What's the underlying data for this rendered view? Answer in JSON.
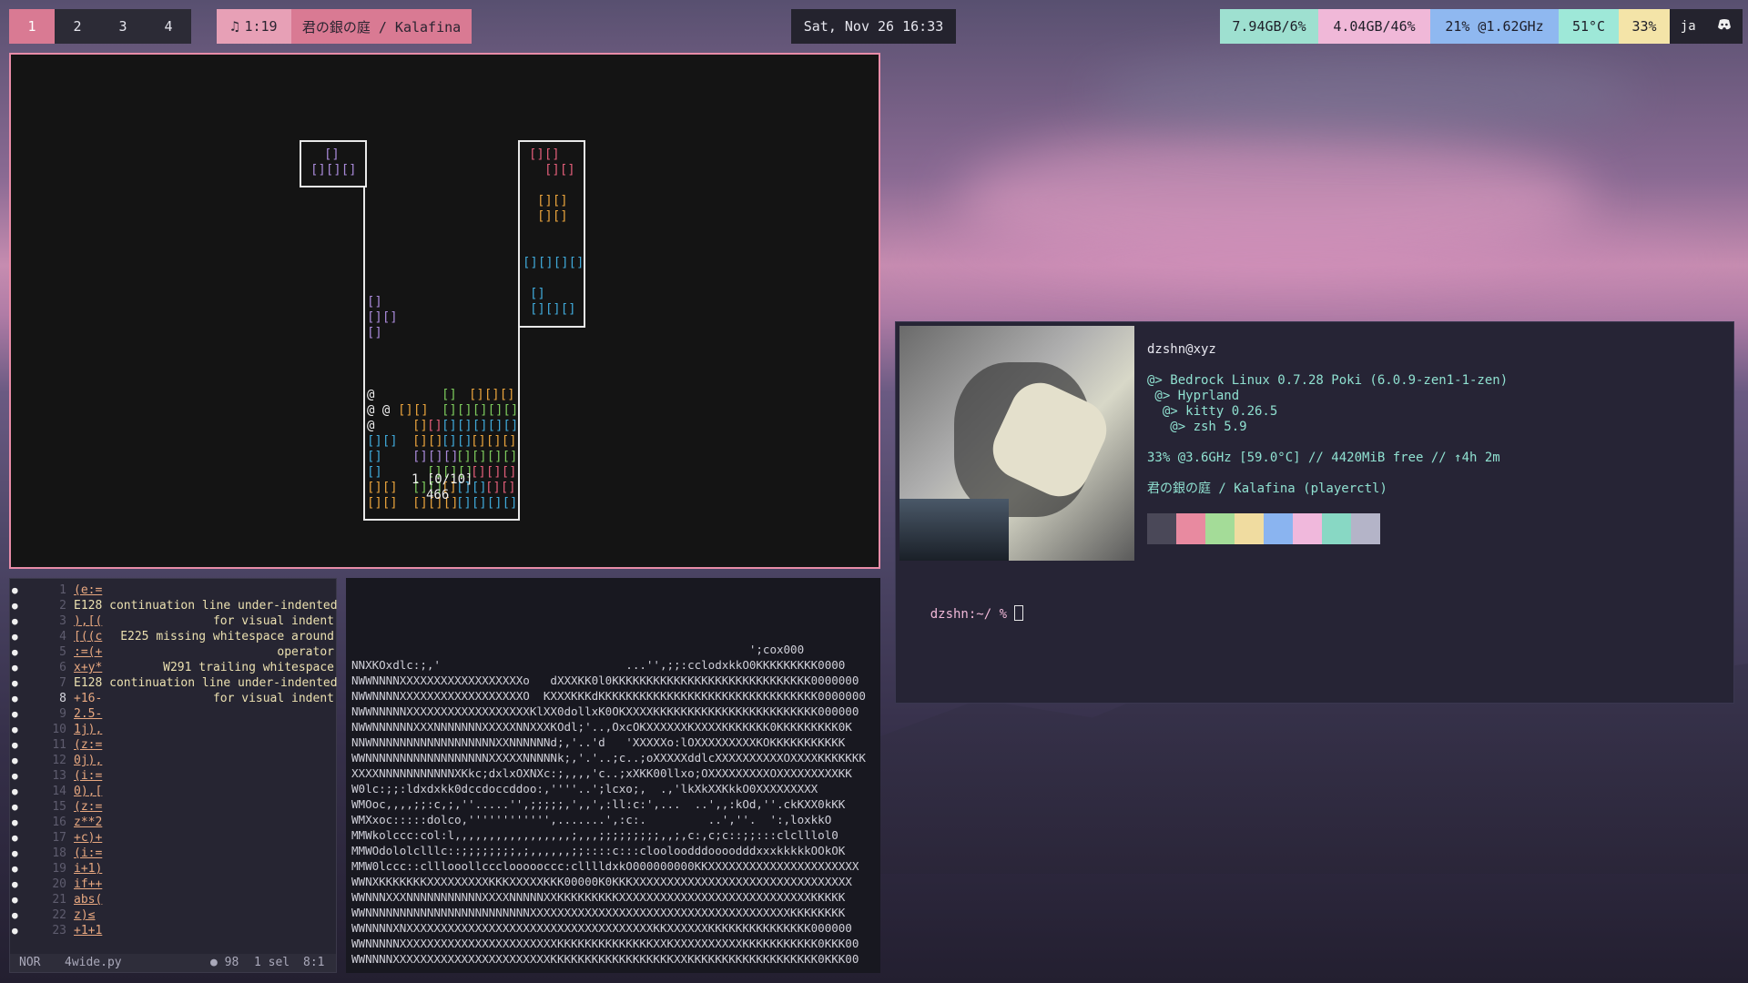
{
  "workspaces": [
    {
      "label": "1",
      "active": true
    },
    {
      "label": "2"
    },
    {
      "label": "3"
    },
    {
      "label": "4"
    }
  ],
  "media": {
    "icon": "music-note-icon",
    "time": "1:19",
    "title": "君の銀の庭 / Kalafina"
  },
  "clock": "Sat, Nov 26 16:33",
  "stats": [
    {
      "name": "disk",
      "text": "7.94GB/6%",
      "color": "#9ee0d0"
    },
    {
      "name": "memory",
      "text": "4.04GB/46%",
      "color": "#f0b8d8"
    },
    {
      "name": "cpu",
      "text": "21% @1.62GHz",
      "color": "#8fb8f0"
    },
    {
      "name": "temperature",
      "text": "51°C",
      "color": "#9ee8d8"
    },
    {
      "name": "battery",
      "text": "33%",
      "color": "#f4e4a8"
    }
  ],
  "locale": "ja",
  "tray_icon": "discord-icon",
  "tetris": {
    "line1": "1 [0/10]",
    "line2": "466"
  },
  "editor": {
    "lines": [
      {
        "n": "1",
        "code": "(e:="
      },
      {
        "n": "2",
        "code": "E128 continuation line under-indented",
        "diag": true
      },
      {
        "n": "3",
        "code": "),[(",
        "diag_text": "for visual indent"
      },
      {
        "n": "4",
        "code": "[((c",
        "diag_text": "E225 missing whitespace around"
      },
      {
        "n": "5",
        "code": ":=(+",
        "diag_text": "operator"
      },
      {
        "n": "6",
        "code": "x+y*",
        "diag_text": "W291 trailing whitespace"
      },
      {
        "n": "7",
        "code": "E128 continuation line under-indented",
        "diag": true
      },
      {
        "n": "8",
        "code": "+16-",
        "diag_text": "for visual indent",
        "current": true
      },
      {
        "n": "9",
        "code": "2.5-"
      },
      {
        "n": "10",
        "code": "1j),"
      },
      {
        "n": "11",
        "code": "(z:="
      },
      {
        "n": "12",
        "code": "0j),"
      },
      {
        "n": "13",
        "code": "(i:="
      },
      {
        "n": "14",
        "code": "0),["
      },
      {
        "n": "15",
        "code": "(z:="
      },
      {
        "n": "16",
        "code": "z**2"
      },
      {
        "n": "17",
        "code": "+c)+"
      },
      {
        "n": "18",
        "code": "(i:="
      },
      {
        "n": "19",
        "code": "i+1)"
      },
      {
        "n": "20",
        "code": "if++"
      },
      {
        "n": "21",
        "code": "abs("
      },
      {
        "n": "22",
        "code": "z)≤"
      },
      {
        "n": "23",
        "code": "+1+1"
      }
    ],
    "status": {
      "mode": "NOR",
      "file": "4wide.py",
      "diagnostics": "● 98",
      "selection": "1 sel",
      "position": "8:1"
    }
  },
  "ascii_art": [
    "                                                          ';cox000",
    "NNXKOxdlc:;,'                           ...'',;;:cclodxkkO0KKKKKKKKK0000",
    "NWWNNNNXXXXXXXXXXXXXXXXXXo   dXXXKK0l0KKKKKKKKKKKKKKKKKKKKKKKKKKKKK0000000",
    "NWWNNNNXXXXXXXXXXXXXXXXXXO  KXXXKKKdKKKKKKKKKKKKKKKKKKKKKKKKKKKKKKKK0000000",
    "NWWNNNNNXXXXXXXXXXXXXXXXXXKlXX0dollxK0OKXXXXKKKKKKKKKKKKKKKKKKKKKKKK000000",
    "NWWNNNNNNXXXNNNNNNNXXXXXNNXXXKOdl;'..,OxcOKXXXXXXKXXXXKKKKKKK0KKKKKKKKK0K",
    "NNWNNNNNNNNNNNNNNNNNNXXNNNNNNd;,'..'d   'XXXXXo:lOXXXXXXXXXKOKKKKKKKKKKK",
    "WWNNNNNNNNNNNNNNNNNNXXXXXNNNNNk;,'.'..;c..;oXXXXXddlcXXXXXXXXXXOXXXXKKKKKKK",
    "XXXXNNNNNNNNNNNXKkc;dxlxOXNXc:;,,,,'c..;xXKK00llxo;OXXXXXXXXXOXXXXXXXXXKK",
    "W0lc:;;:ldxdxkk0dccdoccddoo:,''''..';lcxo;,  .,'lkXkXXKkkO0XXXXXXXXX",
    "WMOoc,,,,;;:c,;,''.....'',;;;;;,',,',:ll:c:',...  ..',,:kOd,''.ckKXX0kKK",
    "WMXxoc:::::dolco,'''''''''''',.......',:c:.         ..',''.  ':,loxkkO",
    "MMWkolccc:col:l,,,,,,,,,,,,,,,,,;,,,;;;;;;;;;,,;,c:,c;c::;;:::clclllol0",
    "MMWOdololclllc::;;;;;;;;,;,,,,,,;;::::c:::clooloodddoooodddxxxkkkkkOOkOK",
    "MMW0lccc::clllooollcccloooooccc:clllldxkO000000000KKXXXXXXXXXXXXXXXXXXXXXX",
    "WWNXKKKKKKKXXXXXXXXXKKKXXXXXKKK00000K0KKKXXXXXXXXXXXXXXXXXXXXXXXXXXXXXXXX",
    "WWNNNXXXNNNNNNNNNNNXXXXNNNNNXXKKKKKKKKKXXXXXXXXXXXXXXXXXXXXXXXXXXXXKKKKK",
    "WWNNNNNNNNNNNNNNNNNNNNNNNNXXXXXXXXXXXXXXXXXXXXXXXXXXXXXXXXXXXXXXKKKKKKKK",
    "WWNNNNXNXXXXXXXXXXXXXXXXXXXXXXXXXXXXXXXXXXXXKKXXXXXXKKKKKKKKKKKKKKK000000",
    "WWNNNNNXXXXXXXXXXXXXXXXXXXXXXXKKKKKKKKKKKKKKXXKXXXXXXXXXXKKKKKKKKKKK0KKK00",
    "WWNNNNXXXXXXXXXXXXXXXXXXXXXXXKKKKKKKKKKKKKKKKKKXXKKKKKKKKKKKKKKKKKKK0KKK00"
  ],
  "fetch": {
    "user": "dzshn@xyz",
    "os": "@> Bedrock Linux 0.7.28 Poki (6.0.9-zen1-1-zen)",
    "wm": " @> Hyprland",
    "term": "  @> kitty 0.26.5",
    "shell": "   @> zsh 5.9",
    "sys": "33% @3.6GHz [59.0°C] // 4420MiB free // ↑4h 2m",
    "music": "君の銀の庭 / Kalafina (playerctl)",
    "palette": [
      "#4a4858",
      "#e88aa0",
      "#a4dc98",
      "#f0dca0",
      "#8ab4f0",
      "#f0b8dc",
      "#88d8c4",
      "#b4b4c8"
    ],
    "prompt": "dzshn:~/ %"
  }
}
